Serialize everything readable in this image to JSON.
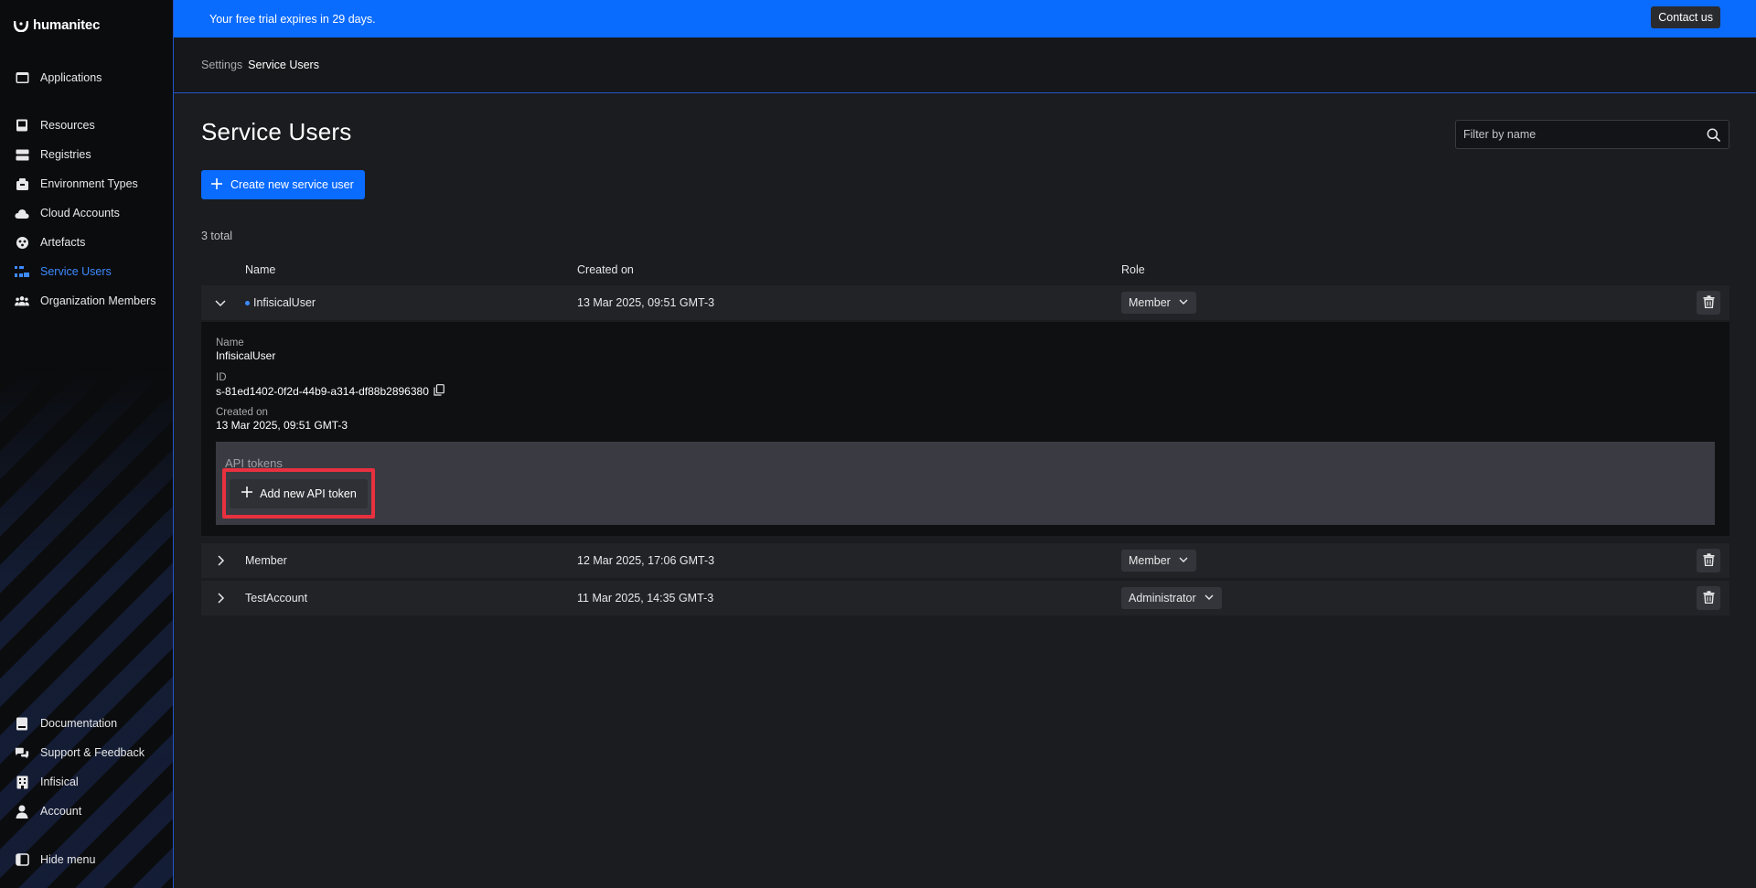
{
  "brand": {
    "name": "humanitec",
    "accent": "#0a6bff",
    "active_nav": "#3d8bff",
    "highlight": "#e8303f"
  },
  "banner": {
    "message": "Your free trial expires in 29 days.",
    "contact_label": "Contact us"
  },
  "sidebar": {
    "top_items": [
      {
        "label": "Applications",
        "icon": "applications-icon"
      }
    ],
    "items": [
      {
        "label": "Resources",
        "icon": "resources-icon"
      },
      {
        "label": "Registries",
        "icon": "registries-icon"
      },
      {
        "label": "Environment Types",
        "icon": "environment-types-icon"
      },
      {
        "label": "Cloud Accounts",
        "icon": "cloud-icon"
      },
      {
        "label": "Artefacts",
        "icon": "artefacts-icon"
      },
      {
        "label": "Service Users",
        "icon": "service-users-icon",
        "active": true
      },
      {
        "label": "Organization Members",
        "icon": "organization-members-icon"
      }
    ],
    "bottom_items": [
      {
        "label": "Documentation",
        "icon": "book-icon"
      },
      {
        "label": "Support & Feedback",
        "icon": "chat-icon"
      },
      {
        "label": "Infisical",
        "icon": "building-icon"
      },
      {
        "label": "Account",
        "icon": "user-icon"
      }
    ],
    "hide_menu_label": "Hide menu"
  },
  "breadcrumb": {
    "parent": "Settings",
    "current": "Service Users"
  },
  "page": {
    "title": "Service Users",
    "filter_placeholder": "Filter by name",
    "create_button_label": "Create new service user",
    "total_label": "3 total"
  },
  "table": {
    "headers": {
      "name": "Name",
      "created": "Created on",
      "role": "Role"
    },
    "rows": [
      {
        "name": "InfisicalUser",
        "created": "13 Mar 2025, 09:51 GMT-3",
        "role": "Member",
        "expanded": true
      },
      {
        "name": "Member",
        "created": "12 Mar 2025, 17:06 GMT-3",
        "role": "Member",
        "expanded": false
      },
      {
        "name": "TestAccount",
        "created": "11 Mar 2025, 14:35 GMT-3",
        "role": "Administrator",
        "expanded": false
      }
    ]
  },
  "details": {
    "name_label": "Name",
    "name_value": "InfisicalUser",
    "id_label": "ID",
    "id_value": "s-81ed1402-0f2d-44b9-a314-df88b2896380",
    "created_label": "Created on",
    "created_value": "13 Mar 2025, 09:51 GMT-3",
    "tokens_title": "API tokens",
    "add_token_label": "Add new API token"
  }
}
